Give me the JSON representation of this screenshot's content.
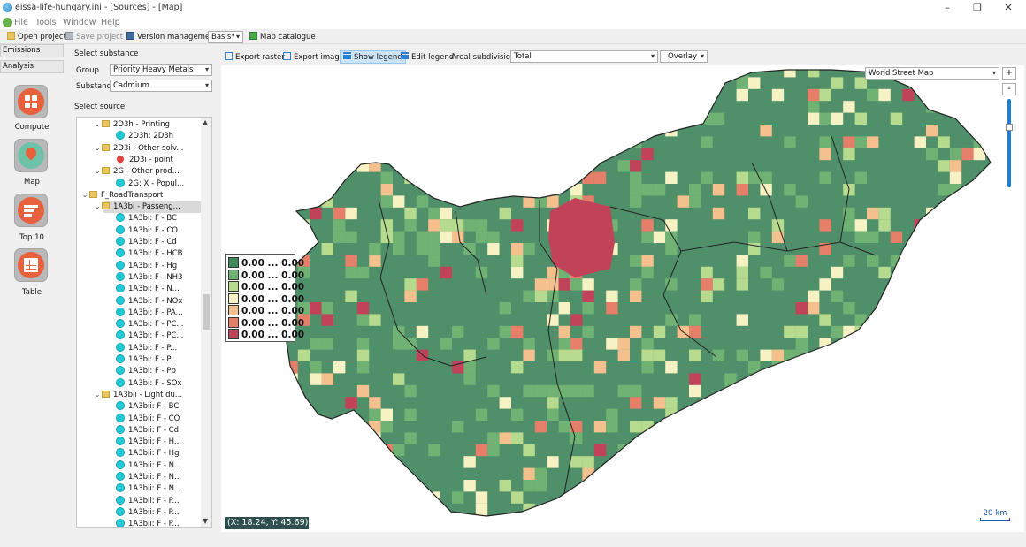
{
  "window": {
    "title": "eissa-life-hungary.ini - [Sources] - [Map]",
    "controls": [
      "–",
      "❐",
      "✕"
    ]
  },
  "menu": [
    "File",
    "Tools",
    "Window",
    "Help"
  ],
  "toolbar": {
    "open_project": "Open project",
    "save_project": "Save project",
    "version_management": "Version management",
    "version_value": "Basis*",
    "map_catalogue": "Map catalogue"
  },
  "left_nav": {
    "tabs": [
      "Emissions",
      "Analysis"
    ],
    "buttons": [
      {
        "label": "Compute",
        "icon": "compute-icon"
      },
      {
        "label": "Map",
        "icon": "map-pin-icon"
      },
      {
        "label": "Top 10",
        "icon": "top10-icon"
      },
      {
        "label": "Table",
        "icon": "table-icon"
      }
    ]
  },
  "substance": {
    "heading": "Select substance",
    "group_label": "Group",
    "group_value": "Priority Heavy Metals",
    "substance_label": "Substance",
    "substance_value": "Cadmium"
  },
  "source": {
    "heading": "Select source",
    "tree": [
      {
        "indent": 1,
        "kind": "folder",
        "expanded": true,
        "label": "2D3h - Printing"
      },
      {
        "indent": 2,
        "kind": "dot",
        "label": "2D3h: 2D3h"
      },
      {
        "indent": 1,
        "kind": "folder",
        "expanded": true,
        "label": "2D3i - Other solv..."
      },
      {
        "indent": 2,
        "kind": "pin",
        "label": "2D3i - point"
      },
      {
        "indent": 1,
        "kind": "folder",
        "expanded": true,
        "label": "2G - Other prod..."
      },
      {
        "indent": 2,
        "kind": "dot",
        "label": "2G: X - Popul..."
      },
      {
        "indent": 0,
        "kind": "folder",
        "expanded": true,
        "label": "F_RoadTransport"
      },
      {
        "indent": 1,
        "kind": "folder",
        "expanded": true,
        "label": "1A3bi - Passeng...",
        "selected": true
      },
      {
        "indent": 2,
        "kind": "dot",
        "label": "1A3bi: F - BC"
      },
      {
        "indent": 2,
        "kind": "dot",
        "label": "1A3bi: F - CO"
      },
      {
        "indent": 2,
        "kind": "dot",
        "label": "1A3bi: F - Cd"
      },
      {
        "indent": 2,
        "kind": "dot",
        "label": "1A3bi: F - HCB"
      },
      {
        "indent": 2,
        "kind": "dot",
        "label": "1A3bi: F - Hg"
      },
      {
        "indent": 2,
        "kind": "dot",
        "label": "1A3bi: F - NH3"
      },
      {
        "indent": 2,
        "kind": "dot",
        "label": "1A3bi: F - N..."
      },
      {
        "indent": 2,
        "kind": "dot",
        "label": "1A3bi: F - NOx"
      },
      {
        "indent": 2,
        "kind": "dot",
        "label": "1A3bi: F - PA..."
      },
      {
        "indent": 2,
        "kind": "dot",
        "label": "1A3bi: F - PC..."
      },
      {
        "indent": 2,
        "kind": "dot",
        "label": "1A3bi: F - PC..."
      },
      {
        "indent": 2,
        "kind": "dot",
        "label": "1A3bi: F - P..."
      },
      {
        "indent": 2,
        "kind": "dot",
        "label": "1A3bi: F - P..."
      },
      {
        "indent": 2,
        "kind": "dot",
        "label": "1A3bi: F - Pb"
      },
      {
        "indent": 2,
        "kind": "dot",
        "label": "1A3bi: F - SOx"
      },
      {
        "indent": 1,
        "kind": "folder",
        "expanded": true,
        "label": "1A3bii - Light du..."
      },
      {
        "indent": 2,
        "kind": "dot",
        "label": "1A3bii: F - BC"
      },
      {
        "indent": 2,
        "kind": "dot",
        "label": "1A3bii: F - CO"
      },
      {
        "indent": 2,
        "kind": "dot",
        "label": "1A3bii: F - Cd"
      },
      {
        "indent": 2,
        "kind": "dot",
        "label": "1A3bii: F - H..."
      },
      {
        "indent": 2,
        "kind": "dot",
        "label": "1A3bii: F - Hg"
      },
      {
        "indent": 2,
        "kind": "dot",
        "label": "1A3bii: F - N..."
      },
      {
        "indent": 2,
        "kind": "dot",
        "label": "1A3bii: F - N..."
      },
      {
        "indent": 2,
        "kind": "dot",
        "label": "1A3bii: F - N..."
      },
      {
        "indent": 2,
        "kind": "dot",
        "label": "1A3bii: F - P..."
      },
      {
        "indent": 2,
        "kind": "dot",
        "label": "1A3bii: F - P..."
      },
      {
        "indent": 2,
        "kind": "dot",
        "label": "1A3bii: F - P..."
      }
    ]
  },
  "map_toolbar": {
    "export_raster": "Export raster",
    "export_image": "Export image",
    "show_legend": "Show legend",
    "edit_legend": "Edit legend",
    "areal_label": "Areal subdivisions:",
    "areal_value": "Total",
    "overlay": "Overlay"
  },
  "map": {
    "basemap": "World Street Map",
    "zoom_in": "+",
    "zoom_out": "-",
    "coords": "(X: 18.24, Y: 45.69)",
    "scale": "20 km",
    "legend": [
      {
        "label": "0.00 ... 0.00",
        "color": "#3a8a5c"
      },
      {
        "label": "0.00 ... 0.00",
        "color": "#6fb273"
      },
      {
        "label": "0.00 ... 0.00",
        "color": "#b6db8e"
      },
      {
        "label": "0.00 ... 0.00",
        "color": "#f7f2c4"
      },
      {
        "label": "0.00 ... 0.00",
        "color": "#f4c08e"
      },
      {
        "label": "0.00 ... 0.00",
        "color": "#e57f6a"
      },
      {
        "label": "0.00 ... 0.00",
        "color": "#c0435a"
      }
    ]
  },
  "colors": {
    "c0": "#4f8f6a",
    "c1": "#6fb273",
    "c2": "#b6db8e",
    "c3": "#f7f2c4",
    "c4": "#f4c08e",
    "c5": "#e57f6a",
    "c6": "#c0435a"
  }
}
